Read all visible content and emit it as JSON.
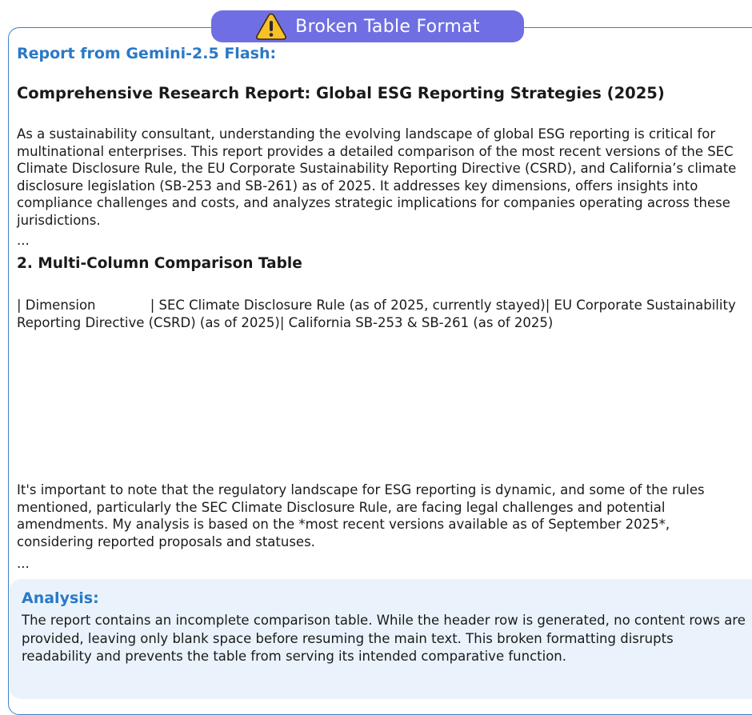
{
  "badge": {
    "icon": "warning-triangle-icon",
    "label": "Broken Table Format",
    "background": "#6f6fe3",
    "icon_color": "#f6c026"
  },
  "report": {
    "label": "Report from Gemini-2.5 Flash:",
    "title": "Comprehensive Research Report: Global ESG Reporting Strategies (2025)",
    "intro": "As a sustainability consultant, understanding the evolving landscape of global ESG reporting is critical for multinational enterprises. This report provides a detailed comparison of the most recent versions of the SEC Climate Disclosure Rule, the EU Corporate Sustainability Reporting Directive (CSRD), and California’s climate disclosure legislation (SB-253 and SB-261) as of 2025. It addresses key dimensions, offers insights into compliance challenges and costs, and analyzes strategic implications for companies operating across these jurisdictions.",
    "ellipsis_1": "...",
    "section_heading": "2. Multi-Column Comparison Table",
    "table_header_line": "| Dimension             | SEC Climate Disclosure Rule (as of 2025, currently stayed)| EU Corporate Sustainability Reporting Directive (CSRD) (as of 2025)| California SB-253 & SB-261 (as of 2025)",
    "note": "It's important to note that the regulatory landscape for ESG reporting is dynamic, and some of the rules mentioned, particularly the SEC Climate Disclosure Rule, are facing legal challenges and potential amendments. My analysis is based on the *most recent versions available as of September 2025*, considering reported proposals and statuses.",
    "ellipsis_2": "..."
  },
  "analysis": {
    "title": "Analysis:",
    "text": "The report contains an incomplete comparison table. While the header row is generated, no content rows are provided, leaving only blank space before resuming the main text. This broken formatting disrupts readability and prevents the table from serving its intended comparative function."
  },
  "colors": {
    "accent": "#2a79c6",
    "frame_border": "#3f7fc9",
    "analysis_background": "#eaf3fb"
  }
}
